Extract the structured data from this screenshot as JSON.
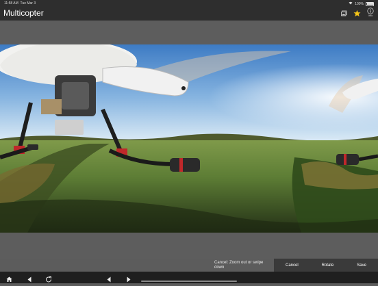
{
  "status": {
    "time": "11:58 AM",
    "date": "Tue Mar 3",
    "battery": "100%"
  },
  "nav": {
    "title": "Multicopter",
    "info_label": "Info"
  },
  "icons": {
    "library": "photo-library-icon",
    "favorite": "star-icon",
    "info": "info-icon",
    "home": "home-icon",
    "back": "back-arrow-icon",
    "refresh": "refresh-icon",
    "prev": "previous-icon",
    "next": "next-icon"
  },
  "colors": {
    "star": "#f5c518",
    "bar": "#2e2e2e"
  },
  "hint": {
    "text": "Cancel: Zoom out or swipe down"
  },
  "controls": {
    "cancel": "Cancel",
    "rotate": "Rotate",
    "save": "Save"
  }
}
